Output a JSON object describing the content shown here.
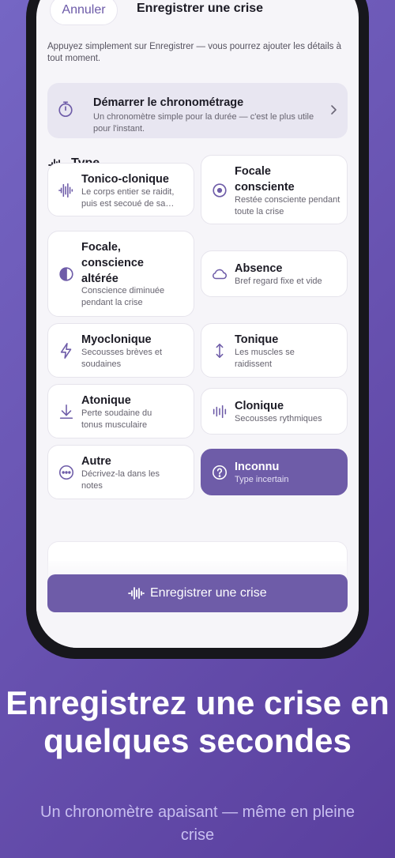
{
  "header": {
    "cancel_label": "Annuler",
    "title": "Enregistrer une crise"
  },
  "hint": "Appuyez simplement sur Enregistrer — vous pourrez ajouter les détails à tout moment.",
  "timer": {
    "title": "Démarrer le chronométrage",
    "subtitle": "Un chronomètre simple pour la durée — c'est le plus utile pour l'instant.",
    "icon": "stopwatch-icon"
  },
  "type_section": {
    "label": "Type",
    "icon": "waveform-icon"
  },
  "types": [
    {
      "name": "tonico-clonique",
      "title": "Tonico-clonique",
      "desc": "Le corps entier se raidit, puis est secoué de sa…",
      "icon": "seizure-wave-icon"
    },
    {
      "name": "focale-consciente",
      "title": "Focale consciente",
      "desc": "Restée consciente pendant toute la crise",
      "icon": "target-icon"
    },
    {
      "name": "focale-alteree",
      "title": "Focale, conscience altérée",
      "desc": "Conscience diminuée pendant la crise",
      "icon": "half-circle-icon"
    },
    {
      "name": "absence",
      "title": "Absence",
      "desc": "Bref regard fixe et vide",
      "icon": "cloud-icon"
    },
    {
      "name": "myoclonique",
      "title": "Myoclonique",
      "desc": "Secousses brèves et soudaines",
      "icon": "lightning-icon"
    },
    {
      "name": "tonique",
      "title": "Tonique",
      "desc": "Les muscles se raidissent",
      "icon": "vertical-arrows-icon"
    },
    {
      "name": "atonique",
      "title": "Atonique",
      "desc": "Perte soudaine du tonus musculaire",
      "icon": "arrow-down-icon"
    },
    {
      "name": "clonique",
      "title": "Clonique",
      "desc": "Secousses rythmiques",
      "icon": "rhythm-bars-icon"
    },
    {
      "name": "autre",
      "title": "Autre",
      "desc": "Décrivez-la dans les notes",
      "icon": "more-dots-icon"
    },
    {
      "name": "inconnu",
      "title": "Inconnu",
      "desc": "Type incertain",
      "icon": "question-icon",
      "selected": true
    }
  ],
  "record_button": {
    "label": "Enregistrer une crise",
    "icon": "waveform-icon"
  },
  "colors": {
    "accent": "#6e5ca8",
    "background": "#6a55b3",
    "screen": "#f6f5f9"
  },
  "marketing": {
    "headline": "Enregistrez une crise en quelques secondes",
    "subline": "Un chronomètre apaisant — même en pleine crise"
  }
}
